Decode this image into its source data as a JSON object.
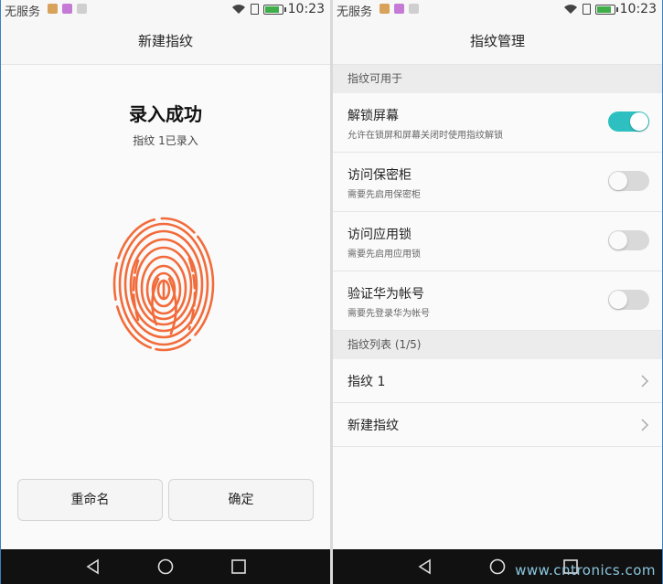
{
  "status_bar": {
    "carrier": "无服务",
    "time": "10:23"
  },
  "left_screen": {
    "title": "新建指纹",
    "success_title": "录入成功",
    "success_sub": "指纹 1已录入",
    "fingerprint_icon": "fingerprint-icon",
    "fingerprint_color": "#f26b3a",
    "buttons": {
      "rename": "重命名",
      "confirm": "确定"
    }
  },
  "right_screen": {
    "title": "指纹管理",
    "section_usage": "指纹可用于",
    "settings": [
      {
        "title": "解锁屏幕",
        "sub": "允许在锁屏和屏幕关闭时使用指纹解锁",
        "on": true
      },
      {
        "title": "访问保密柜",
        "sub": "需要先启用保密柜",
        "on": false
      },
      {
        "title": "访问应用锁",
        "sub": "需要先启用应用锁",
        "on": false
      },
      {
        "title": "验证华为帐号",
        "sub": "需要先登录华为帐号",
        "on": false
      }
    ],
    "section_list": "指纹列表 (1/5)",
    "list": [
      {
        "title": "指纹 1"
      },
      {
        "title": "新建指纹"
      }
    ]
  },
  "colors": {
    "accent": "#2ec0c0",
    "navbar": "#111111"
  },
  "watermark": "www.cntronics.com"
}
